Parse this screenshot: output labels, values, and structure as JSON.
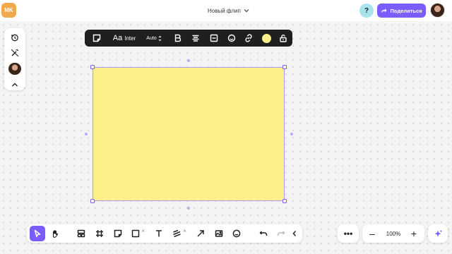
{
  "header": {
    "user_initials": "MK",
    "doc_title": "Новый флип",
    "help_label": "?",
    "share_label": "Поделиться"
  },
  "left_panel": {
    "items": [
      "history-icon",
      "magic-wand-off-icon",
      "avatar",
      "chevron-up-icon"
    ]
  },
  "format_toolbar": {
    "font_label": "Inter",
    "font_prefix": "Aa",
    "size_label": "Auto",
    "sticky_color": "#fdf08a"
  },
  "canvas": {
    "sticky_color": "#fdf08a",
    "selection_color": "#7b5cff"
  },
  "bottom_toolbar": {
    "tools": [
      "select",
      "hand",
      "layout",
      "frame",
      "sticky-note",
      "shape",
      "text",
      "pen",
      "arrow",
      "image",
      "emoji",
      "undo",
      "redo",
      "collapse"
    ],
    "active_tool": "select"
  },
  "zoom": {
    "more_label": "•••",
    "minus_label": "–",
    "value": "100%",
    "plus_label": "+"
  },
  "colors": {
    "accent": "#7b5cff",
    "user_badge": "#f2a94a",
    "help_bg": "#a9e3ee",
    "toolbar_dark": "#1f1f21"
  }
}
